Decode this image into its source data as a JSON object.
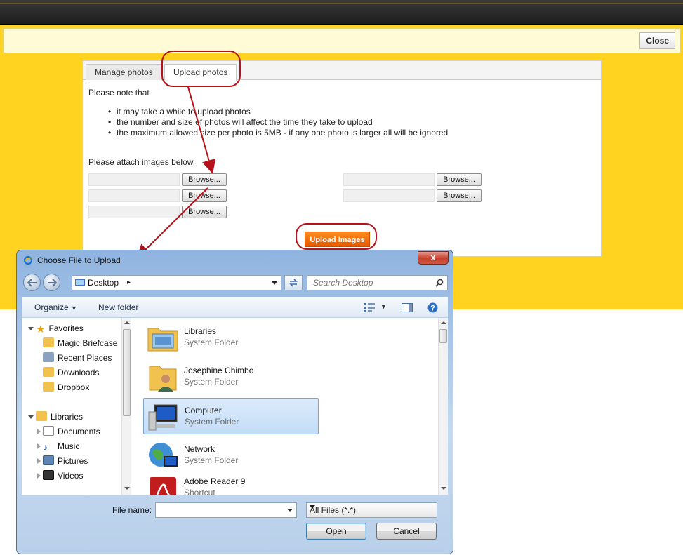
{
  "notice": {
    "close_label": "Close"
  },
  "tabs": [
    {
      "label": "Manage photos"
    },
    {
      "label": "Upload photos"
    }
  ],
  "upload": {
    "note_heading": "Please note that",
    "notes": [
      "it may take a while to upload photos",
      "the number and size of photos will affect the time they take to upload",
      "the maximum allowed size per photo is 5MB - if any one photo is larger all will be ignored"
    ],
    "attach_label": "Please attach images below.",
    "browse_label": "Browse...",
    "upload_button": "Upload Images"
  },
  "dialog": {
    "title": "Choose File to Upload",
    "close_glyph": "x",
    "address": "Desktop",
    "search_placeholder": "Search Desktop",
    "organize": "Organize",
    "new_folder": "New folder",
    "nav": {
      "favorites": "Favorites",
      "favorites_items": [
        "Magic Briefcase",
        "Recent Places",
        "Downloads",
        "Dropbox"
      ],
      "libraries": "Libraries",
      "libraries_items": [
        "Documents",
        "Music",
        "Pictures",
        "Videos"
      ]
    },
    "files": [
      {
        "name": "Libraries",
        "type": "System Folder"
      },
      {
        "name": "Josephine Chimbo",
        "type": "System Folder"
      },
      {
        "name": "Computer",
        "type": "System Folder"
      },
      {
        "name": "Network",
        "type": "System Folder"
      },
      {
        "name": "Adobe Reader 9",
        "type": "Shortcut"
      }
    ],
    "file_name_label": "File name:",
    "file_name_value": "",
    "filter": "All Files (*.*)",
    "open": "Open",
    "cancel": "Cancel"
  },
  "colors": {
    "page_yellow": "#ffd31f",
    "upload_orange": "#ff8a1c",
    "annotation_red": "#b7121a"
  }
}
